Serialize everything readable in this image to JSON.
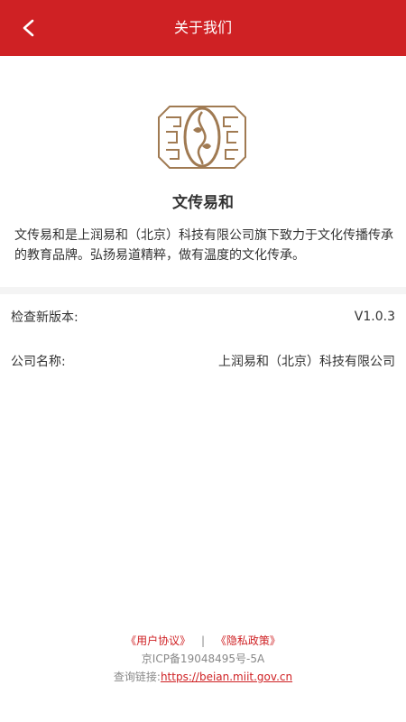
{
  "header": {
    "title": "关于我们",
    "back_icon": "chevron-left-icon"
  },
  "intro": {
    "app_name": "文传易和",
    "description": "文传易和是上润易和（北京）科技有限公司旗下致力于文化传播传承的教育品牌。弘扬易道精粹，做有温度的文化传承。"
  },
  "rows": {
    "version": {
      "label": "检查新版本:",
      "value": "V1.0.3"
    },
    "company": {
      "label": "公司名称:",
      "value": "上润易和（北京）科技有限公司"
    }
  },
  "footer": {
    "user_agreement": "《用户协议》",
    "divider": "|",
    "privacy_policy": "《隐私政策》",
    "icp": "京ICP备19048495号-5A",
    "query_label": "查询链接:",
    "query_url": "https://beian.miit.gov.cn"
  },
  "colors": {
    "brand": "#cf2124",
    "logo": "#a07a52",
    "background": "#ffffff"
  }
}
